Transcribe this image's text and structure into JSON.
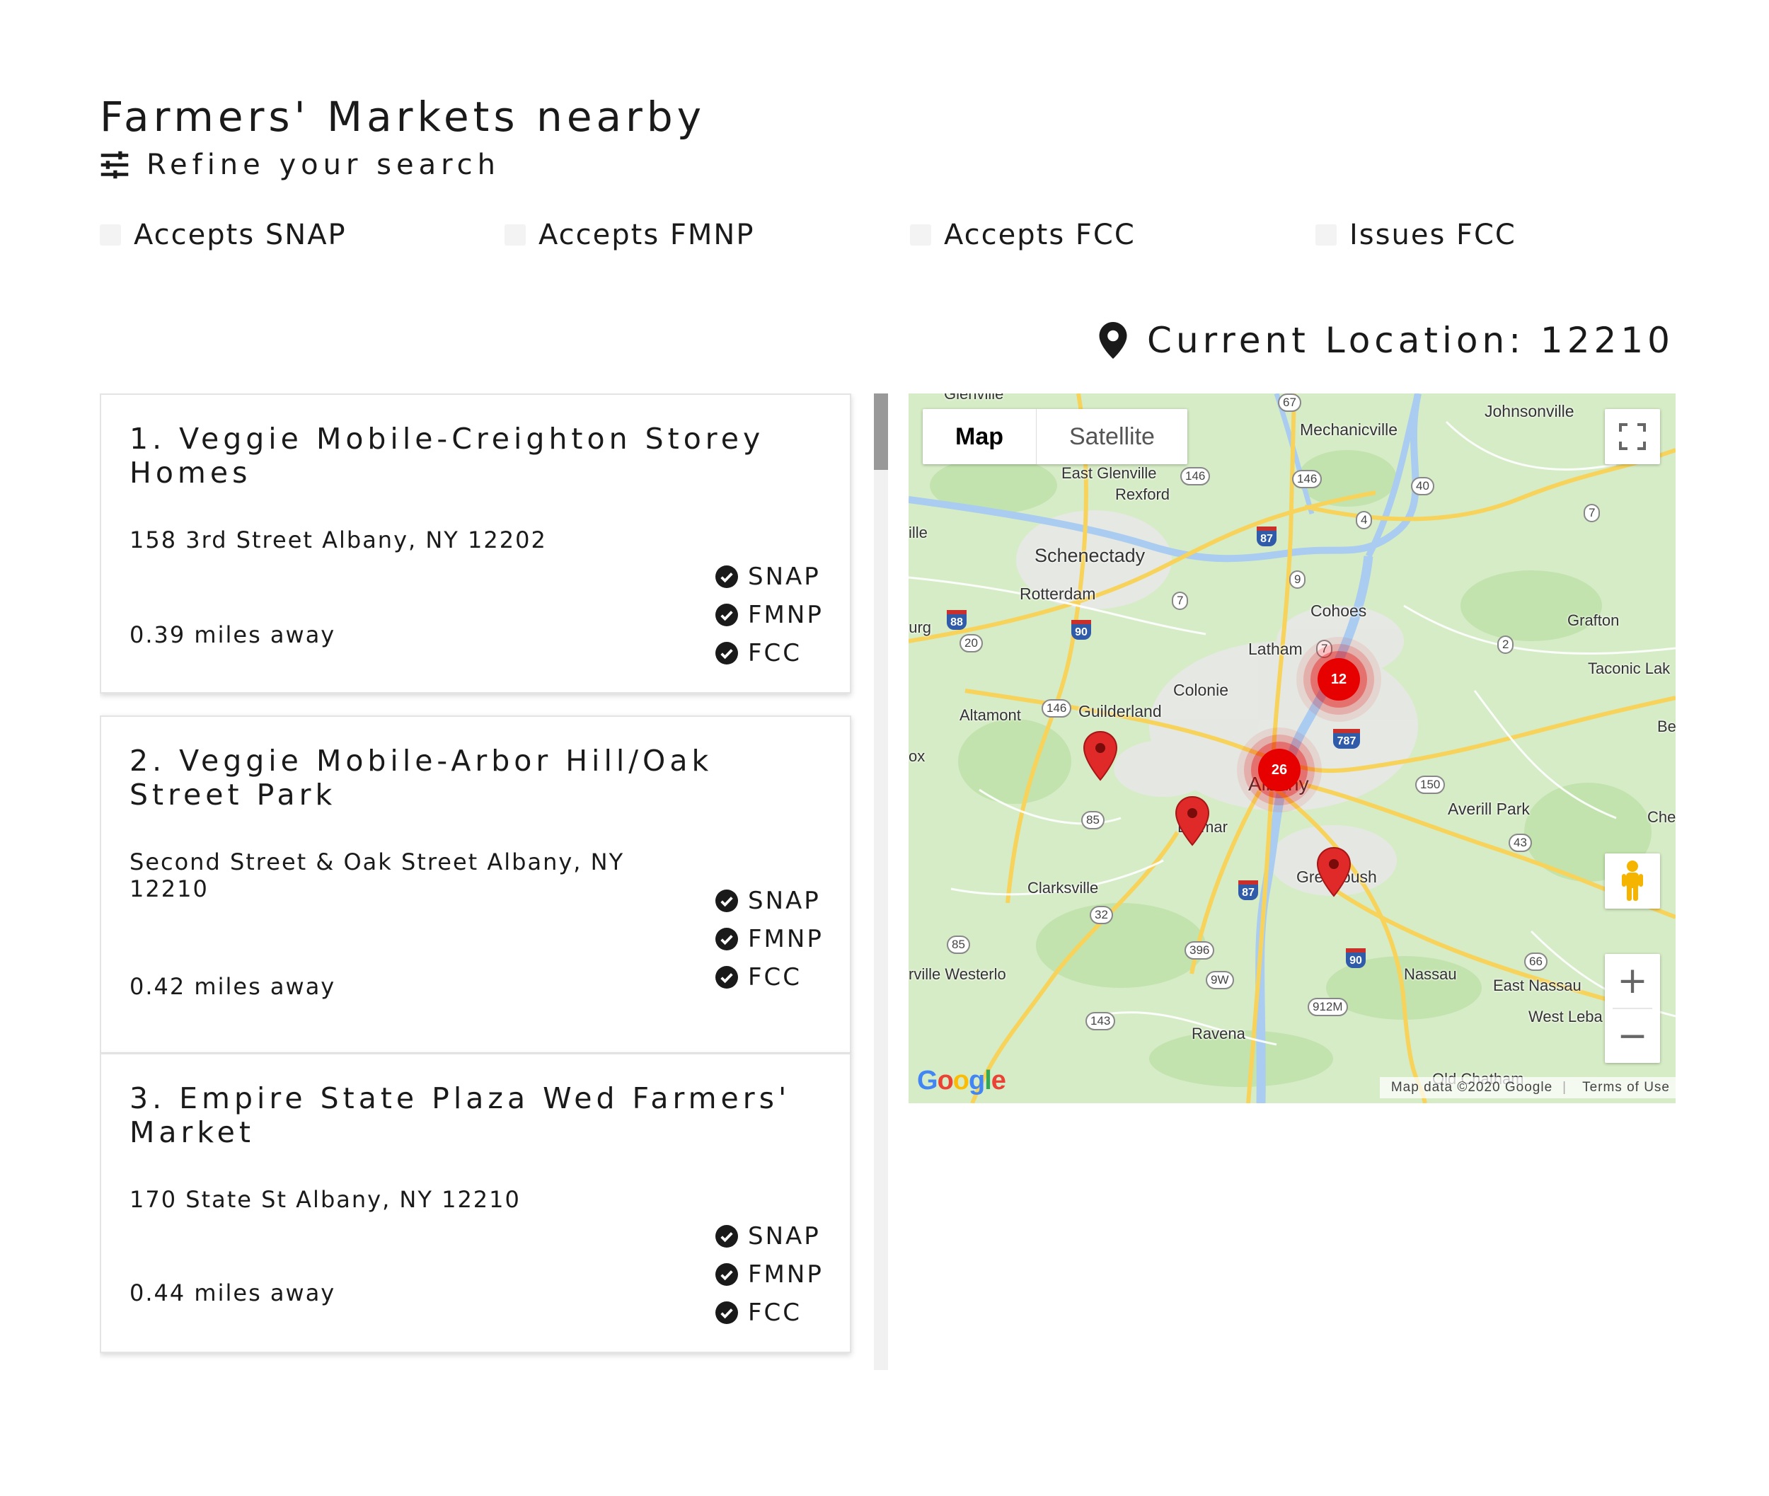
{
  "page": {
    "title": "Farmers' Markets nearby"
  },
  "refine": {
    "icon": "sliders-icon",
    "label": "Refine your search"
  },
  "filters": [
    {
      "label": "Accepts SNAP",
      "checked": false
    },
    {
      "label": "Accepts FMNP",
      "checked": false
    },
    {
      "label": "Accepts FCC",
      "checked": false
    },
    {
      "label": "Issues FCC",
      "checked": false
    }
  ],
  "location": {
    "icon": "map-pin-icon",
    "label": "Current Location: 12210"
  },
  "markets": [
    {
      "name": "1. Veggie Mobile-Creighton Storey Homes",
      "address": "158 3rd Street Albany, NY 12202",
      "distance": "0.39 miles away",
      "badges": [
        "SNAP",
        "FMNP",
        "FCC"
      ]
    },
    {
      "name": "2. Veggie Mobile-Arbor Hill/Oak Street Park",
      "address": "Second Street & Oak Street Albany, NY 12210",
      "distance": "0.42 miles away",
      "badges": [
        "SNAP",
        "FMNP",
        "FCC"
      ]
    },
    {
      "name": "3. Empire State Plaza Wed Farmers' Market",
      "address": "170 State St Albany, NY 12210",
      "distance": "0.44 miles away",
      "badges": [
        "SNAP",
        "FMNP",
        "FCC"
      ]
    }
  ],
  "map": {
    "type_map": "Map",
    "type_satellite": "Satellite",
    "selected_type": "Map",
    "clusters": [
      "12",
      "26"
    ],
    "logo": "Google",
    "attribution": "Map data ©2020 Google",
    "terms": "Terms of Use",
    "places": {
      "glenville": "Glenville",
      "johnsonville": "Johnsonville",
      "mechanicville": "Mechanicville",
      "east_glenville": "East Glenville",
      "rexford": "Rexford",
      "schenectady": "Schenectady",
      "rotterdam": "Rotterdam",
      "cohoes": "Cohoes",
      "grafton": "Grafton",
      "latham": "Latham",
      "taconic": "Taconic Lak",
      "colonie": "Colonie",
      "altamont": "Altamont",
      "guilderland": "Guilderland",
      "albany": "Albany",
      "delmar": "Delmar",
      "averill_park": "Averill Park",
      "clarksville": "Clarksville",
      "greenbush": "Greenbush",
      "westerlo": "rville Westerlo",
      "nassau": "Nassau",
      "east_nassau": "East Nassau",
      "west_leba": "West Leba",
      "ravena": "Ravena",
      "old_chatham": "Old Chatham",
      "ille": "ille",
      "urg": "ourg",
      "ox": "ox",
      "che": "Che",
      "be": "Be"
    },
    "routes": {
      "r67": "67",
      "r146a": "146",
      "r146b": "146",
      "r40": "40",
      "r4": "4",
      "r7a": "7",
      "r9": "9",
      "r7b": "7",
      "r7c": "7",
      "r2": "2",
      "r20": "20",
      "r146c": "146",
      "r150": "150",
      "r85a": "85",
      "r43": "43",
      "r32": "32",
      "r85b": "85",
      "r396": "396",
      "r9w": "9W",
      "r66": "66",
      "r912": "912M",
      "r143": "143"
    },
    "interstates": {
      "i87a": "87",
      "i88": "88",
      "i90a": "90",
      "i787": "787",
      "i87b": "87",
      "i90b": "90"
    }
  },
  "colors": {
    "pin": "#e02a2a",
    "cluster": "#e60000",
    "map_land": "#d6ecc6",
    "highway": "#f7d35c",
    "water": "#a9ccf0"
  }
}
